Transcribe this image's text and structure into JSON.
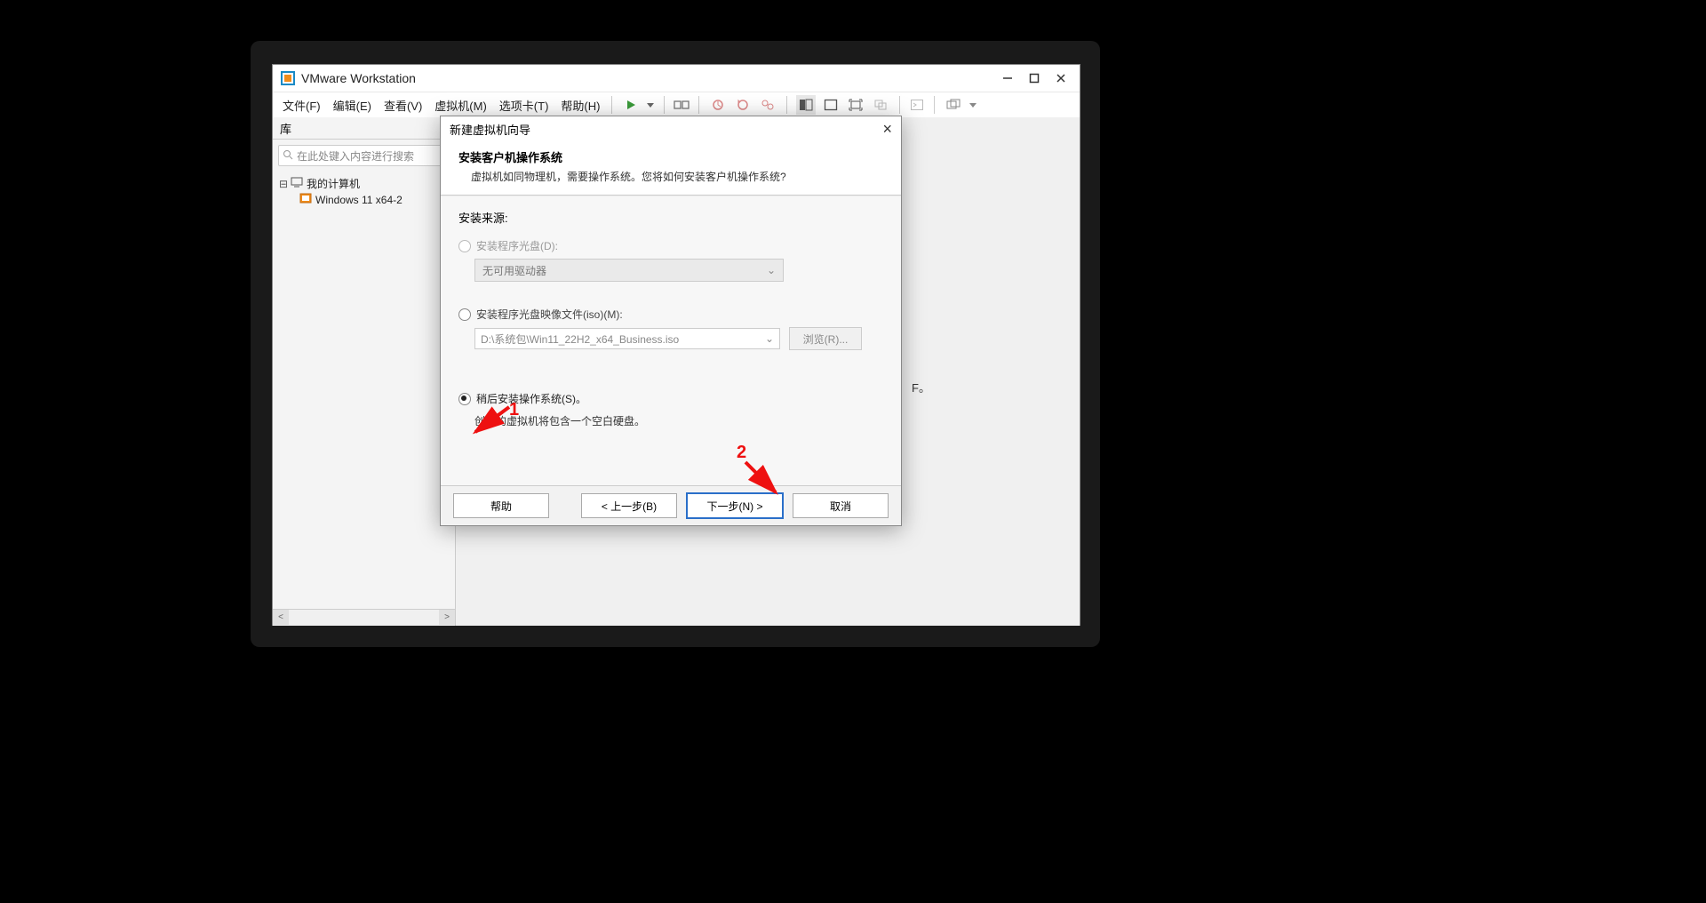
{
  "titlebar": {
    "title": "VMware Workstation"
  },
  "menubar": {
    "items": [
      "文件(F)",
      "编辑(E)",
      "查看(V)",
      "虚拟机(M)",
      "选项卡(T)",
      "帮助(H)"
    ]
  },
  "sidebar": {
    "title": "库",
    "search_placeholder": "在此处键入内容进行搜索",
    "root": "我的计算机",
    "child": "Windows 11 x64-2"
  },
  "wizard": {
    "title": "新建虚拟机向导",
    "heading": "安装客户机操作系统",
    "subheading": "虚拟机如同物理机，需要操作系统。您将如何安装客户机操作系统?",
    "source_label": "安装来源:",
    "opt_disc": "安装程序光盘(D):",
    "disc_none": "无可用驱动器",
    "opt_iso": "安装程序光盘映像文件(iso)(M):",
    "iso_path": "D:\\系统包\\Win11_22H2_x64_Business.iso",
    "browse": "浏览(R)...",
    "opt_later": "稍后安装操作系统(S)。",
    "later_desc": "创建的虚拟机将包含一个空白硬盘。",
    "help": "帮助",
    "back": "< 上一步(B)",
    "next": "下一步(N) >",
    "cancel": "取消"
  },
  "annot": {
    "one": "1",
    "two": "2"
  },
  "lone_char": "F。"
}
